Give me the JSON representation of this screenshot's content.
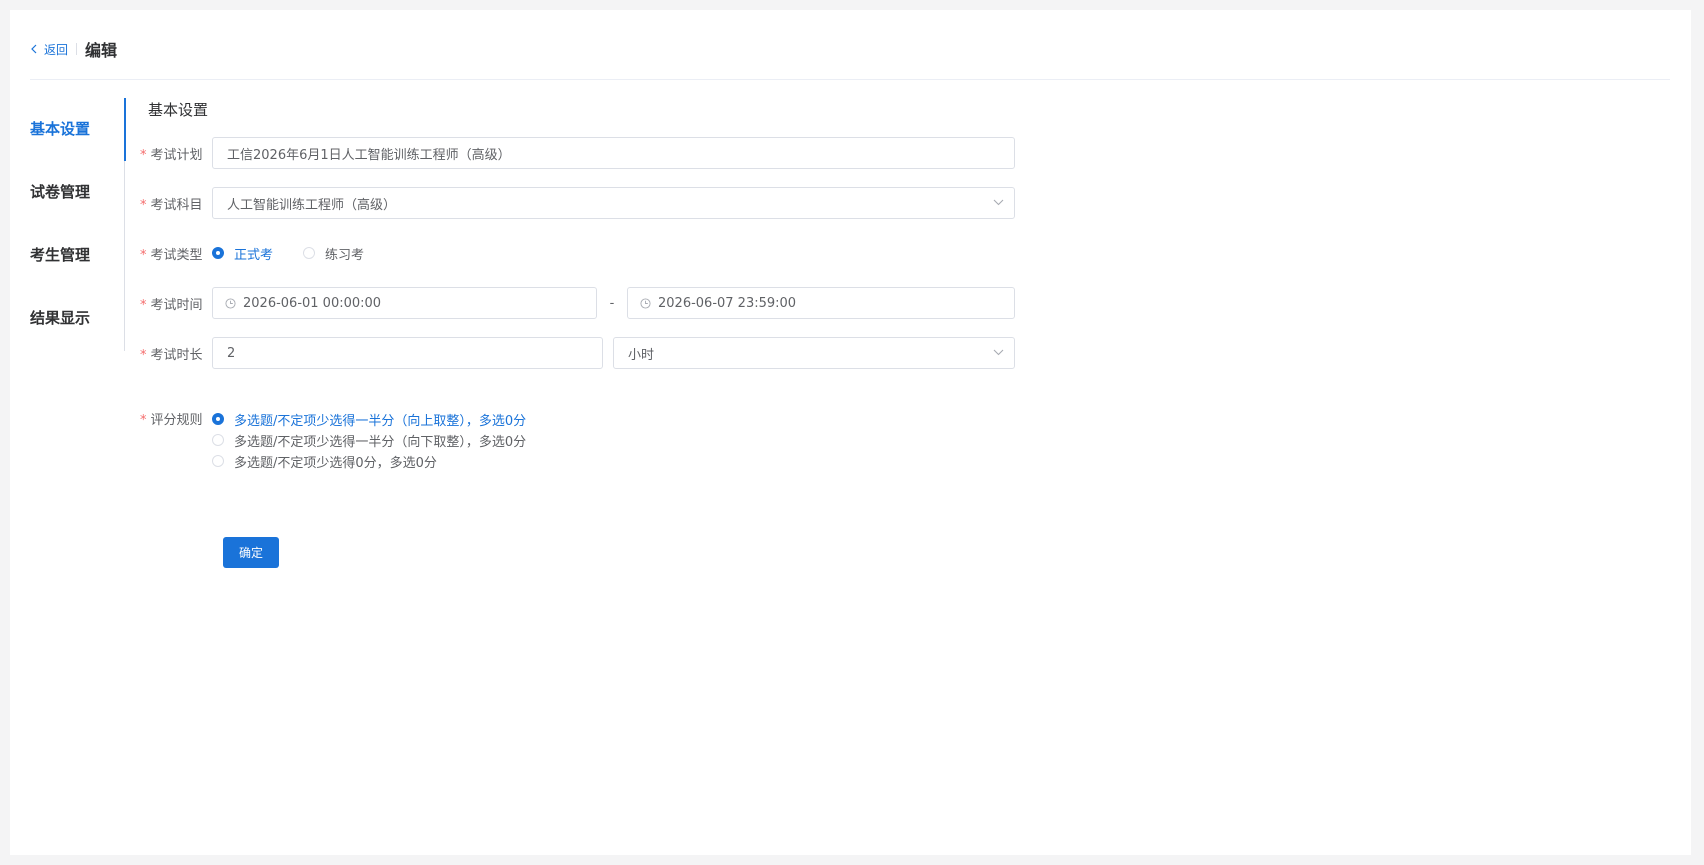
{
  "header": {
    "back_label": "返回",
    "title": "编辑"
  },
  "nav": {
    "items": [
      {
        "label": "基本设置",
        "active": true
      },
      {
        "label": "试卷管理",
        "active": false
      },
      {
        "label": "考生管理",
        "active": false
      },
      {
        "label": "结果显示",
        "active": false
      }
    ]
  },
  "section_title": "基本设置",
  "form": {
    "exam_plan": {
      "label": "考试计划",
      "value": "工信2026年6月1日人工智能训练工程师（高级）"
    },
    "exam_subject": {
      "label": "考试科目",
      "value": "人工智能训练工程师（高级）"
    },
    "exam_type": {
      "label": "考试类型",
      "options": [
        "正式考",
        "练习考"
      ],
      "selected": "正式考"
    },
    "exam_time": {
      "label": "考试时间",
      "start": "2026-06-01 00:00:00",
      "separator": "-",
      "end": "2026-06-07 23:59:00"
    },
    "exam_duration": {
      "label": "考试时长",
      "value": "2",
      "unit": "小时"
    },
    "scoring_rule": {
      "label": "评分规则",
      "options": [
        "多选题/不定项少选得一半分（向上取整），多选0分",
        "多选题/不定项少选得一半分（向下取整），多选0分",
        "多选题/不定项少选得0分，多选0分"
      ],
      "selected_index": 0
    },
    "required_mark": "*",
    "confirm_label": "确定"
  },
  "colors": {
    "accent": "#1a73d9",
    "required": "#f56c6c",
    "border": "#dcdfe6"
  }
}
